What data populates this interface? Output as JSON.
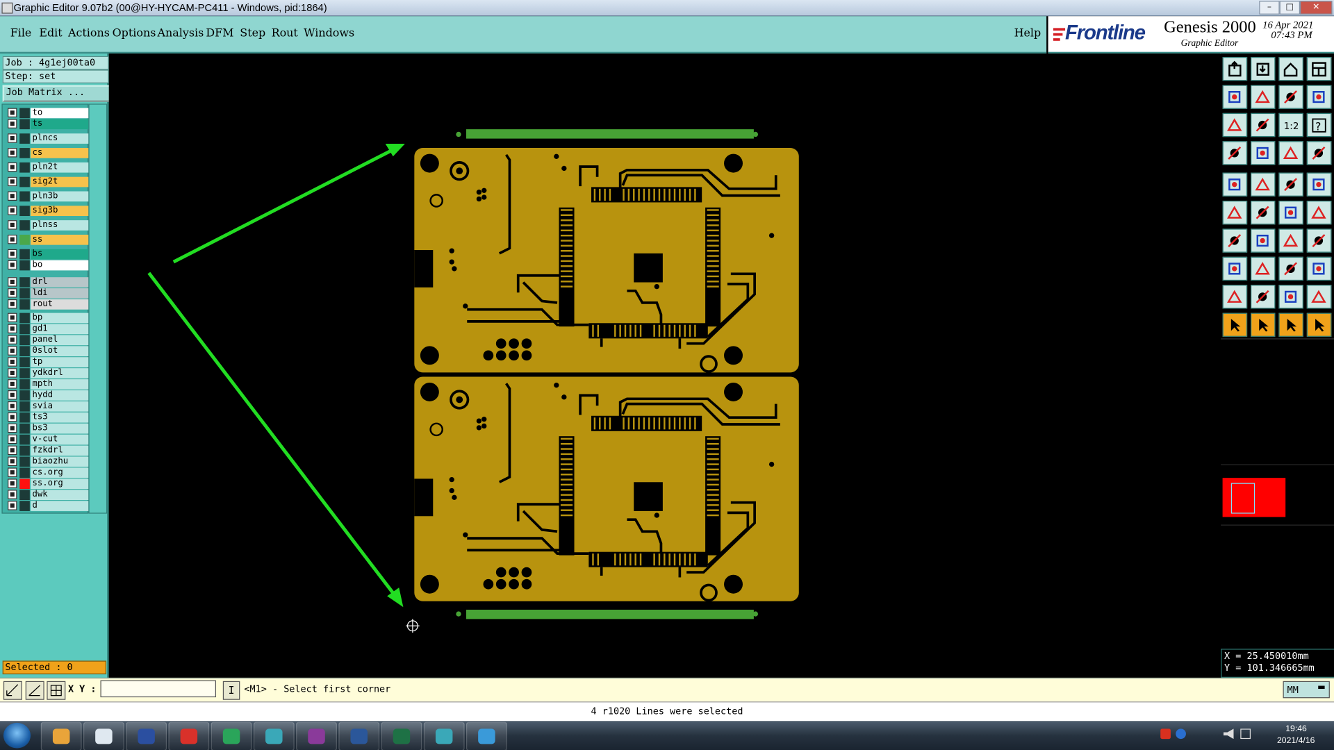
{
  "window": {
    "title": "Graphic Editor 9.07b2 (00@HY-HYCAM-PC411 - Windows, pid:1864)"
  },
  "menu": {
    "items": [
      "File",
      "Edit",
      "Actions",
      "Options",
      "Analysis",
      "DFM",
      "Step",
      "Rout",
      "Windows"
    ],
    "help": "Help"
  },
  "brand": {
    "logo": "Frontline",
    "product": "Genesis 2000",
    "subtitle": "Graphic Editor",
    "date": "16 Apr 2021",
    "time": "07:43 PM"
  },
  "job": {
    "job_label": "Job : 4g1ej00ta0",
    "step_label": "Step: set",
    "matrix_button": "Job Matrix ..."
  },
  "layers": [
    {
      "name": "to",
      "color": "#ffffff"
    },
    {
      "name": "ts",
      "color": "#1fa98b"
    },
    {
      "name": "plncs",
      "color": "#b9e6e2"
    },
    {
      "name": "cs",
      "color": "#f6c24c"
    },
    {
      "name": "pln2t",
      "color": "#b9e6e2"
    },
    {
      "name": "sig2t",
      "color": "#f6c24c"
    },
    {
      "name": "pln3b",
      "color": "#b9e6e2"
    },
    {
      "name": "sig3b",
      "color": "#f6c24c"
    },
    {
      "name": "plnss",
      "color": "#b9e6e2"
    },
    {
      "name": "ss",
      "color": "#f6c24c"
    },
    {
      "name": "bs",
      "color": "#1fa98b"
    },
    {
      "name": "bo",
      "color": "#ffffff"
    },
    {
      "name": "drl",
      "color": "#b7c6c9"
    },
    {
      "name": "ldi",
      "color": "#b7c6c9"
    },
    {
      "name": "rout",
      "color": "#dcdcdc"
    },
    {
      "name": "bp",
      "color": "#b9e6e2"
    },
    {
      "name": "gd1",
      "color": "#b9e6e2"
    },
    {
      "name": "panel",
      "color": "#b9e6e2"
    },
    {
      "name": "0slot",
      "color": "#b9e6e2"
    },
    {
      "name": "tp",
      "color": "#b9e6e2"
    },
    {
      "name": "ydkdrl",
      "color": "#b9e6e2"
    },
    {
      "name": "mpth",
      "color": "#b9e6e2"
    },
    {
      "name": "hydd",
      "color": "#b9e6e2"
    },
    {
      "name": "svia",
      "color": "#b9e6e2"
    },
    {
      "name": "ts3",
      "color": "#b9e6e2"
    },
    {
      "name": "bs3",
      "color": "#b9e6e2"
    },
    {
      "name": "v-cut",
      "color": "#b9e6e2"
    },
    {
      "name": "fzkdrl",
      "color": "#b9e6e2"
    },
    {
      "name": "biaozhu",
      "color": "#b9e6e2"
    },
    {
      "name": "cs.org",
      "color": "#b9e6e2"
    },
    {
      "name": "ss.org",
      "color": "#b9e6e2"
    },
    {
      "name": "dwk",
      "color": "#b9e6e2"
    },
    {
      "name": "d",
      "color": "#b9e6e2"
    }
  ],
  "selected": "Selected : 0",
  "coords": {
    "x": "X = 25.450010mm",
    "y": "Y = 101.346665mm"
  },
  "command": {
    "xy_label": "X Y :",
    "xy_value": "",
    "prompt": "<M1> - Select first corner",
    "units": "MM"
  },
  "status": "4 r1020 Lines were selected",
  "clock": {
    "time": "19:46",
    "date": "2021/4/16"
  },
  "colors": {
    "board": "#b8930e",
    "annotation_arrow": "#22dd22",
    "accent_panel": "#5ccabe",
    "highlight": "#ff0000"
  },
  "icons": [
    "start-orb-icon",
    "shell-icon",
    "notepad-icon",
    "save-disk-icon",
    "genesis-g-icon",
    "p-app-icon",
    "eye-app-icon",
    "x-app-icon",
    "word-icon",
    "excel-icon",
    "eye-app2-icon",
    "telegram-icon"
  ]
}
